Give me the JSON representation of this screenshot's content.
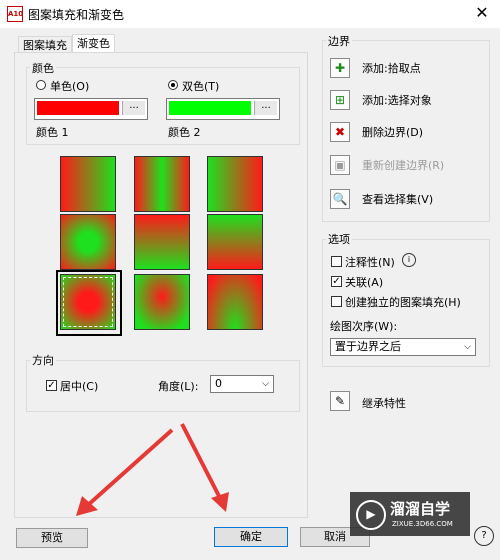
{
  "window": {
    "title": "图案填充和渐变色",
    "icon_text": "A10",
    "close_glyph": "✕"
  },
  "tabs": [
    {
      "label": "图案填充"
    },
    {
      "label": "渐变色",
      "active": true
    }
  ],
  "color": {
    "group_label": "颜色",
    "single_label": "单色(O)",
    "double_label": "双色(T)",
    "color1_label": "颜色 1",
    "color2_label": "颜色 2",
    "color1": "#ff0000",
    "color2": "#00ff00",
    "browse_glyph": "..."
  },
  "direction": {
    "group_label": "方向",
    "center_label": "居中(C)",
    "center_checked": true,
    "angle_label": "角度(L):",
    "angle_value": "0"
  },
  "boundary": {
    "group_label": "边界",
    "add_pick": "添加:拾取点",
    "add_select": "添加:选择对象",
    "remove": "删除边界(D)",
    "recreate": "重新创建边界(R)",
    "view": "查看选择集(V)"
  },
  "options": {
    "group_label": "选项",
    "annotative_label": "注释性(N)",
    "associative_label": "关联(A)",
    "associative_checked": true,
    "separate_label": "创建独立的图案填充(H)",
    "draw_order_label": "绘图次序(W):",
    "draw_order_value": "置于边界之后"
  },
  "inherit_label": "继承特性",
  "buttons": {
    "preview": "预览",
    "ok": "确定",
    "cancel": "取消"
  },
  "watermark": {
    "title": "溜溜自学",
    "url": "ZIXUE.3D66.COM"
  }
}
